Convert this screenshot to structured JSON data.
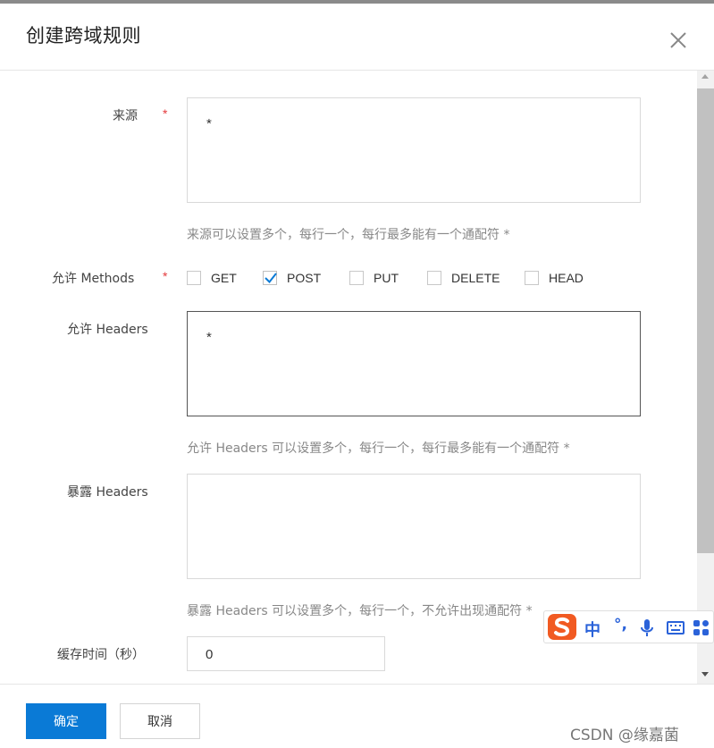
{
  "dialog": {
    "title": "创建跨域规则",
    "close_icon": "close-icon"
  },
  "form": {
    "origin": {
      "label": "来源",
      "required_mark": "*",
      "value": "*",
      "hint": "来源可以设置多个，每行一个，每行最多能有一个通配符 *"
    },
    "methods": {
      "label": "允许 Methods",
      "required_mark": "*",
      "options": [
        {
          "label": "GET",
          "checked": false
        },
        {
          "label": "POST",
          "checked": true
        },
        {
          "label": "PUT",
          "checked": false
        },
        {
          "label": "DELETE",
          "checked": false
        },
        {
          "label": "HEAD",
          "checked": false
        }
      ]
    },
    "allow_headers": {
      "label": "允许 Headers",
      "value": "*",
      "hint": "允许 Headers 可以设置多个，每行一个，每行最多能有一个通配符 *"
    },
    "expose_headers": {
      "label": "暴露 Headers",
      "value": "",
      "hint": "暴露 Headers 可以设置多个，每行一个，不允许出现通配符 *"
    },
    "cache_time": {
      "label": "缓存时间（秒）",
      "value": "0"
    }
  },
  "footer": {
    "confirm_label": "确定",
    "cancel_label": "取消",
    "watermark": "CSDN @缘嘉菌"
  },
  "ime": {
    "mode_label": "中",
    "punct_label": "°,",
    "icons": [
      "sogou-logo-icon",
      "microphone-icon",
      "keyboard-icon",
      "toolbox-icon"
    ]
  },
  "colors": {
    "primary": "#0a7ad6",
    "required": "#e4393c",
    "checkbox_check": "#0a7ad6",
    "ime_blue": "#2a62d9",
    "ime_orange": "#f15a22"
  }
}
